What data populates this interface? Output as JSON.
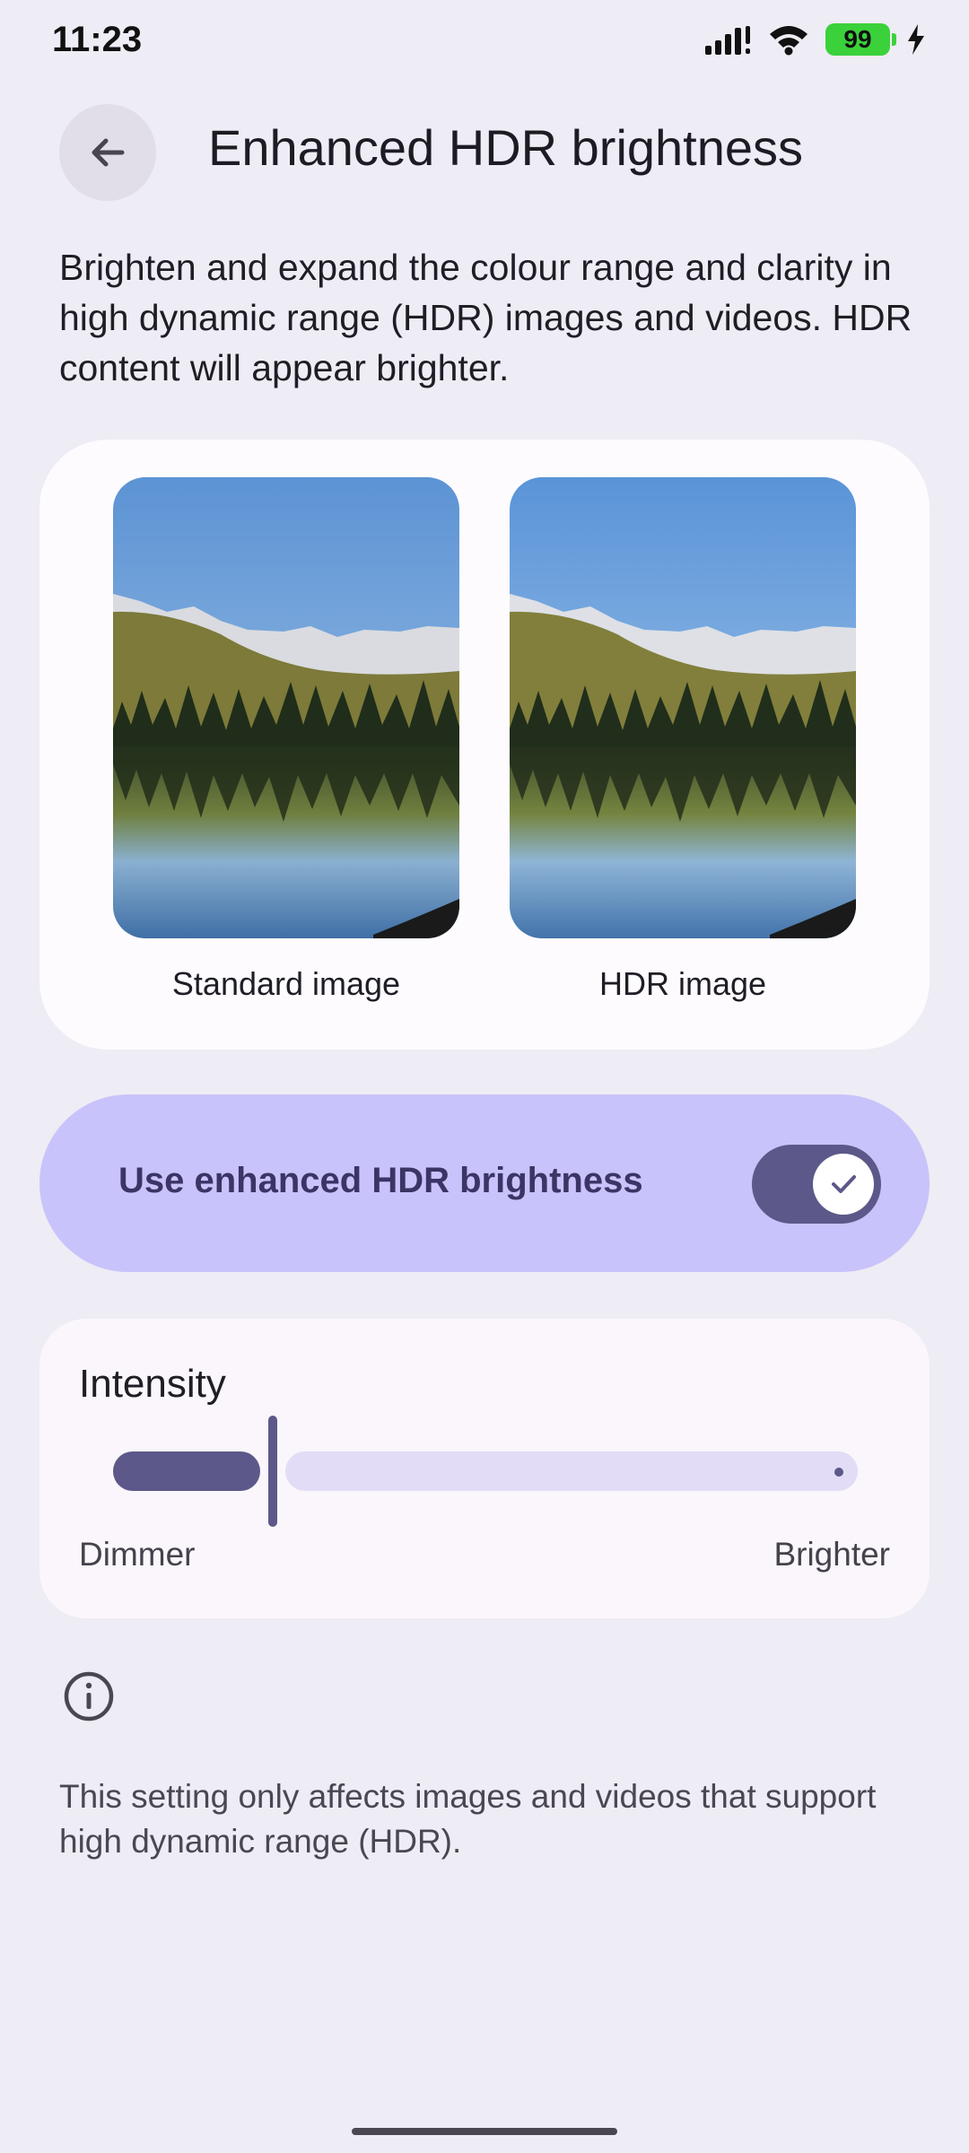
{
  "status_bar": {
    "time": "11:23",
    "battery_level": "99",
    "battery_color": "#3bd13b"
  },
  "header": {
    "title": "Enhanced HDR brightness",
    "back_icon": "arrow-left-icon"
  },
  "description": "Brighten and expand the colour range and clarity in high dynamic range (HDR) images and videos. HDR content will appear brighter.",
  "preview": {
    "standard_label": "Standard image",
    "hdr_label": "HDR image"
  },
  "toggle": {
    "label": "Use enhanced HDR brightness",
    "state": "on",
    "check_icon": "check-icon"
  },
  "intensity": {
    "title": "Intensity",
    "min_label": "Dimmer",
    "max_label": "Brighter",
    "value": 0.2
  },
  "info": {
    "icon": "info-icon",
    "note": "This setting only affects images and videos that support high dynamic range (HDR)."
  },
  "colors": {
    "accent": "#5c5889",
    "toggle_background": "#c9c3fb",
    "page_background": "#eeecf4"
  }
}
